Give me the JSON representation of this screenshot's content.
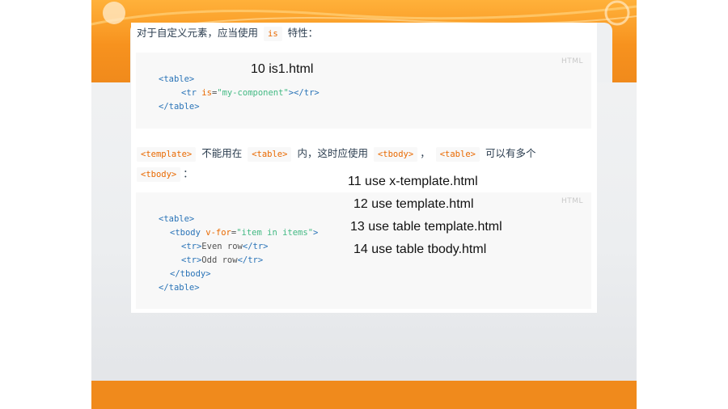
{
  "paragraph1": {
    "prefix": "对于自定义元素，应当使用",
    "inline_code": "is",
    "suffix": "特性："
  },
  "code_block_1": {
    "lang_label": "HTML",
    "lines": [
      {
        "t1": "<table>"
      },
      {
        "t1": "<tr",
        "a1": " is",
        "eq": "=",
        "s1": "\"my-component\"",
        "t2": "></tr>"
      },
      {
        "t1": "</table>"
      }
    ]
  },
  "paragraph2": {
    "code_template": "<template>",
    "text1": "不能用在",
    "code_table": "<table>",
    "text2": "内，这时应使用",
    "code_tbody": "<tbody>",
    "comma": "，",
    "code_table2": "<table>",
    "text3": "可以有多个",
    "code_tbody2": "<tbody>",
    "colon": "："
  },
  "code_block_2": {
    "lang_label": "HTML",
    "lines": [
      {
        "t1": "<table>"
      },
      {
        "t1": "<tbody",
        "a1": " v-for",
        "eq": "=",
        "s1": "\"item in items\"",
        "t2": ">"
      },
      {
        "t1": "<tr>",
        "txt": "Even row",
        "t2": "</tr>"
      },
      {
        "t1": "<tr>",
        "txt": "Odd row",
        "t2": "</tr>"
      },
      {
        "t1": "</tbody>"
      },
      {
        "t1": "</table>"
      }
    ]
  },
  "overlay_labels": [
    "10 is1.html",
    "11 use x-template.html",
    "12 use template.html",
    "13 use table template.html",
    "14 use table tbody.html"
  ],
  "colors": {
    "orange": "#f08a1c",
    "code_tag": "#2973b7",
    "code_attr": "#e96900",
    "code_string": "#42b983"
  }
}
